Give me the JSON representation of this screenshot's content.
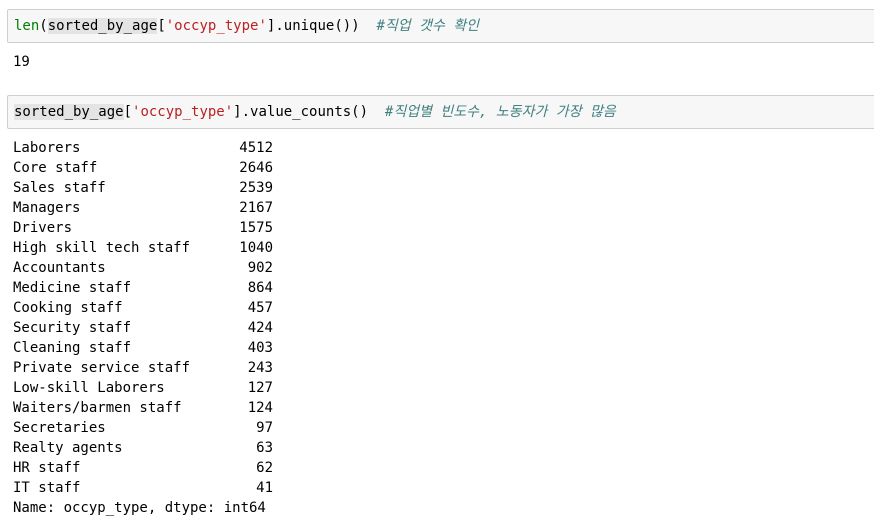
{
  "cell1": {
    "code_builtin": "len",
    "code_paren_open": "(",
    "code_var": "sorted_by_age",
    "code_bracket_open": "[",
    "code_string": "'occyp_type'",
    "code_rest": "].unique())  ",
    "code_comment": "#직업 갯수 확인",
    "output": "19"
  },
  "cell2": {
    "code_var": "sorted_by_age",
    "code_bracket_open": "[",
    "code_string": "'occyp_type'",
    "code_rest": "].value_counts()  ",
    "code_comment": "#직업별 빈도수, 노동자가 가장 많음",
    "rows": [
      {
        "label": "Laborers",
        "count": "4512"
      },
      {
        "label": "Core staff",
        "count": "2646"
      },
      {
        "label": "Sales staff",
        "count": "2539"
      },
      {
        "label": "Managers",
        "count": "2167"
      },
      {
        "label": "Drivers",
        "count": "1575"
      },
      {
        "label": "High skill tech staff",
        "count": "1040"
      },
      {
        "label": "Accountants",
        "count": "902"
      },
      {
        "label": "Medicine staff",
        "count": "864"
      },
      {
        "label": "Cooking staff",
        "count": "457"
      },
      {
        "label": "Security staff",
        "count": "424"
      },
      {
        "label": "Cleaning staff",
        "count": "403"
      },
      {
        "label": "Private service staff",
        "count": "243"
      },
      {
        "label": "Low-skill Laborers",
        "count": "127"
      },
      {
        "label": "Waiters/barmen staff",
        "count": "124"
      },
      {
        "label": "Secretaries",
        "count": "97"
      },
      {
        "label": "Realty agents",
        "count": "63"
      },
      {
        "label": "HR staff",
        "count": "62"
      },
      {
        "label": "IT staff",
        "count": "41"
      }
    ],
    "dtype_line": "Name: occyp_type, dtype: int64"
  }
}
